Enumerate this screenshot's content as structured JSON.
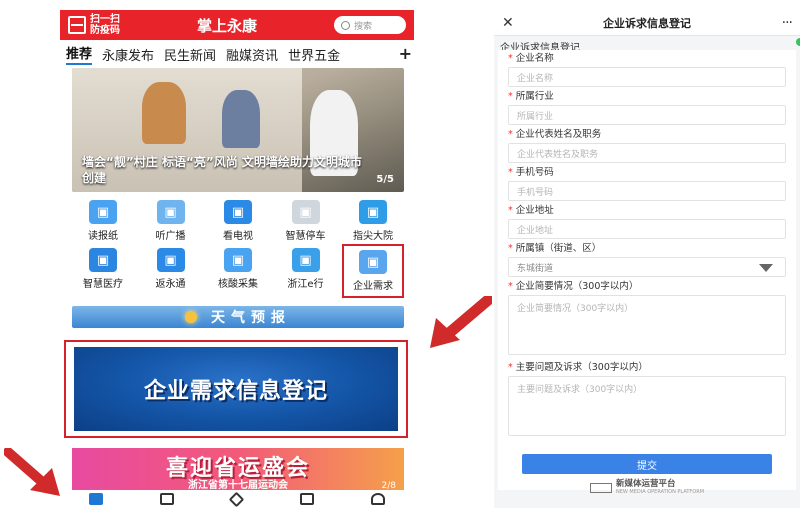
{
  "left": {
    "scan_label": "扫一扫\n防疫码",
    "app_title": "掌上永康",
    "search_placeholder": "搜索",
    "tabs": [
      "推荐",
      "永康发布",
      "民生新闻",
      "融媒资讯",
      "世界五金"
    ],
    "active_tab": 0,
    "banner": {
      "caption": "墙会“靓”村庄 标语“亮”风尚 文明墙绘助力文明城市创建",
      "page": "5/5"
    },
    "grid_row1": [
      {
        "label": "读报纸",
        "icon": "newspaper-icon",
        "color": "#4aa3f0"
      },
      {
        "label": "听广播",
        "icon": "radio-icon",
        "color": "#6fb4ef"
      },
      {
        "label": "看电视",
        "icon": "tv-icon",
        "color": "#2b8ae6"
      },
      {
        "label": "智慧停车",
        "icon": "parking-icon",
        "color": "#cfd6de"
      },
      {
        "label": "指尖大院",
        "icon": "fingertip-icon",
        "color": "#2f9ce8"
      }
    ],
    "grid_row2": [
      {
        "label": "智慧医疗",
        "icon": "hospital-icon",
        "color": "#2b86e2"
      },
      {
        "label": "返永通",
        "icon": "return-icon",
        "color": "#2b8ae6"
      },
      {
        "label": "核酸采集",
        "icon": "test-tube-icon",
        "color": "#4aa3f0"
      },
      {
        "label": "浙江e行",
        "icon": "zhejiang-travel-icon",
        "color": "#3aa0ea"
      },
      {
        "label": "企业需求",
        "icon": "edit-icon",
        "color": "#5aa6ee"
      }
    ],
    "weather_text": "天气预报",
    "demand_text": "企业需求信息登记",
    "games": {
      "title": "喜迎省运盛会",
      "subtitle": "浙江省第十七届运动会",
      "page": "2/8"
    },
    "accent_red": "#d6202a",
    "accent_blue": "#1f78d1"
  },
  "right": {
    "title": "企业诉求信息登记",
    "form_title": "企业诉求信息登记",
    "fields": [
      {
        "label": "企业名称",
        "placeholder": "企业名称"
      },
      {
        "label": "所属行业",
        "placeholder": "所属行业"
      },
      {
        "label": "企业代表姓名及职务",
        "placeholder": "企业代表姓名及职务"
      },
      {
        "label": "手机号码",
        "placeholder": "手机号码"
      },
      {
        "label": "企业地址",
        "placeholder": "企业地址"
      }
    ],
    "select_field": {
      "label": "所属镇（街道、区）",
      "value": "东城街道"
    },
    "textareas": [
      {
        "label": "企业简要情况（300字以内）",
        "placeholder": "企业简要情况（300字以内）"
      },
      {
        "label": "主要问题及诉求（300字以内）",
        "placeholder": "主要问题及诉求（300字以内）"
      }
    ],
    "required_mark": "*",
    "submit_label": "提交",
    "footer_text": "新媒体运营平台",
    "footer_sub": "NEW MEDIA OPERATION PLATFORM",
    "submit_color": "#3b82e6"
  }
}
